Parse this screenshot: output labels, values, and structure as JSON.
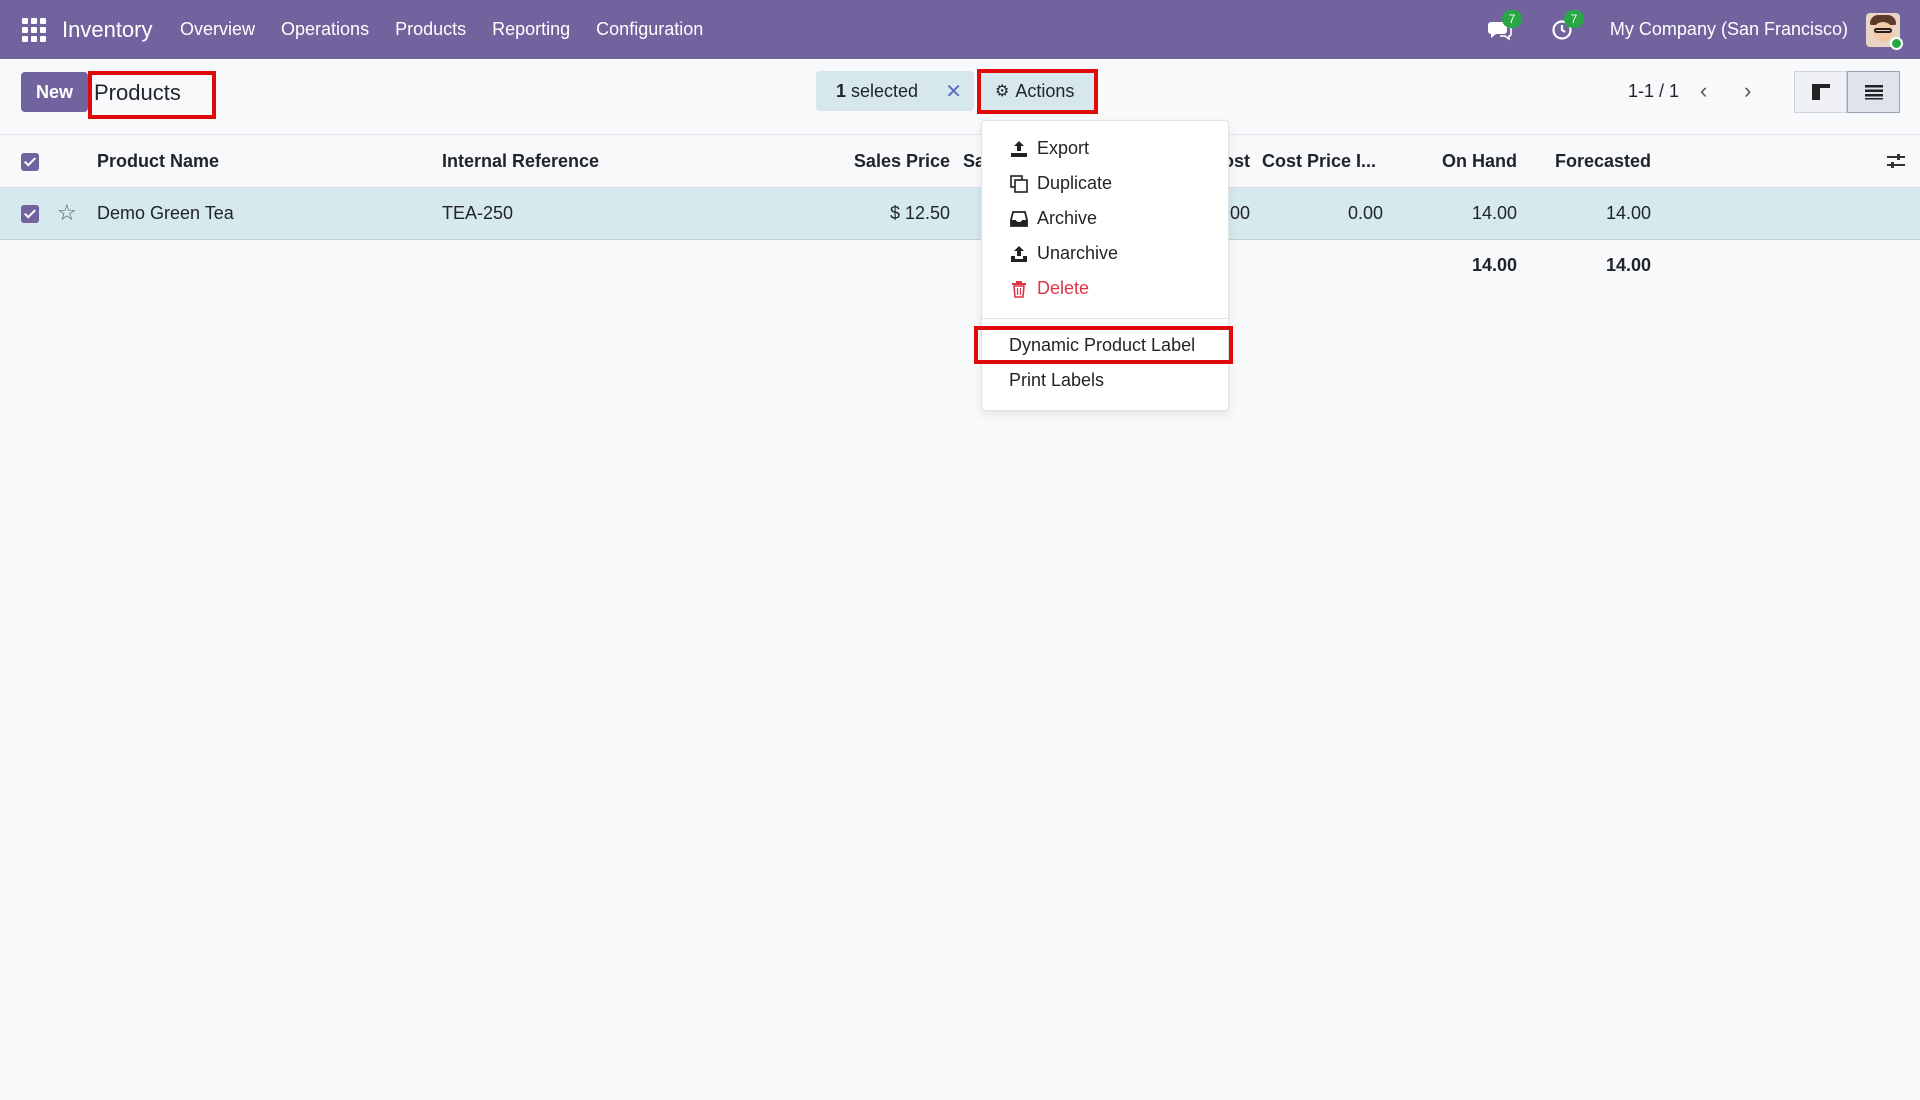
{
  "navbar": {
    "brand": "Inventory",
    "menu": [
      "Overview",
      "Operations",
      "Products",
      "Reporting",
      "Configuration"
    ],
    "messages_count": "7",
    "activities_count": "7",
    "company": "My Company (San Francisco)"
  },
  "control_panel": {
    "new_label": "New",
    "title": "Products",
    "selected_count": "1",
    "selected_label": "selected",
    "actions_label": "Actions",
    "pager": "1-1 / 1"
  },
  "table": {
    "headers": {
      "product_name": "Product Name",
      "internal_reference": "Internal Reference",
      "sales_price": "Sales Price",
      "sales_partial": "Sa",
      "cost_partial": "ost",
      "cost_price": "Cost Price I...",
      "on_hand": "On Hand",
      "forecasted": "Forecasted"
    },
    "row": {
      "product_name": "Demo Green Tea",
      "internal_reference": "TEA-250",
      "sales_price": "$ 12.50",
      "cost_partial": "00",
      "cost_price": "0.00",
      "on_hand": "14.00",
      "forecasted": "14.00"
    },
    "totals": {
      "on_hand": "14.00",
      "forecasted": "14.00"
    }
  },
  "actions_menu": {
    "export": "Export",
    "duplicate": "Duplicate",
    "archive": "Archive",
    "unarchive": "Unarchive",
    "delete": "Delete",
    "dynamic_label": "Dynamic Product Label",
    "print_labels": "Print Labels"
  },
  "colors": {
    "brand": "#71639e",
    "selected_row": "#d5e9ee",
    "highlight": "#e00a0a",
    "danger": "#dc3545"
  }
}
